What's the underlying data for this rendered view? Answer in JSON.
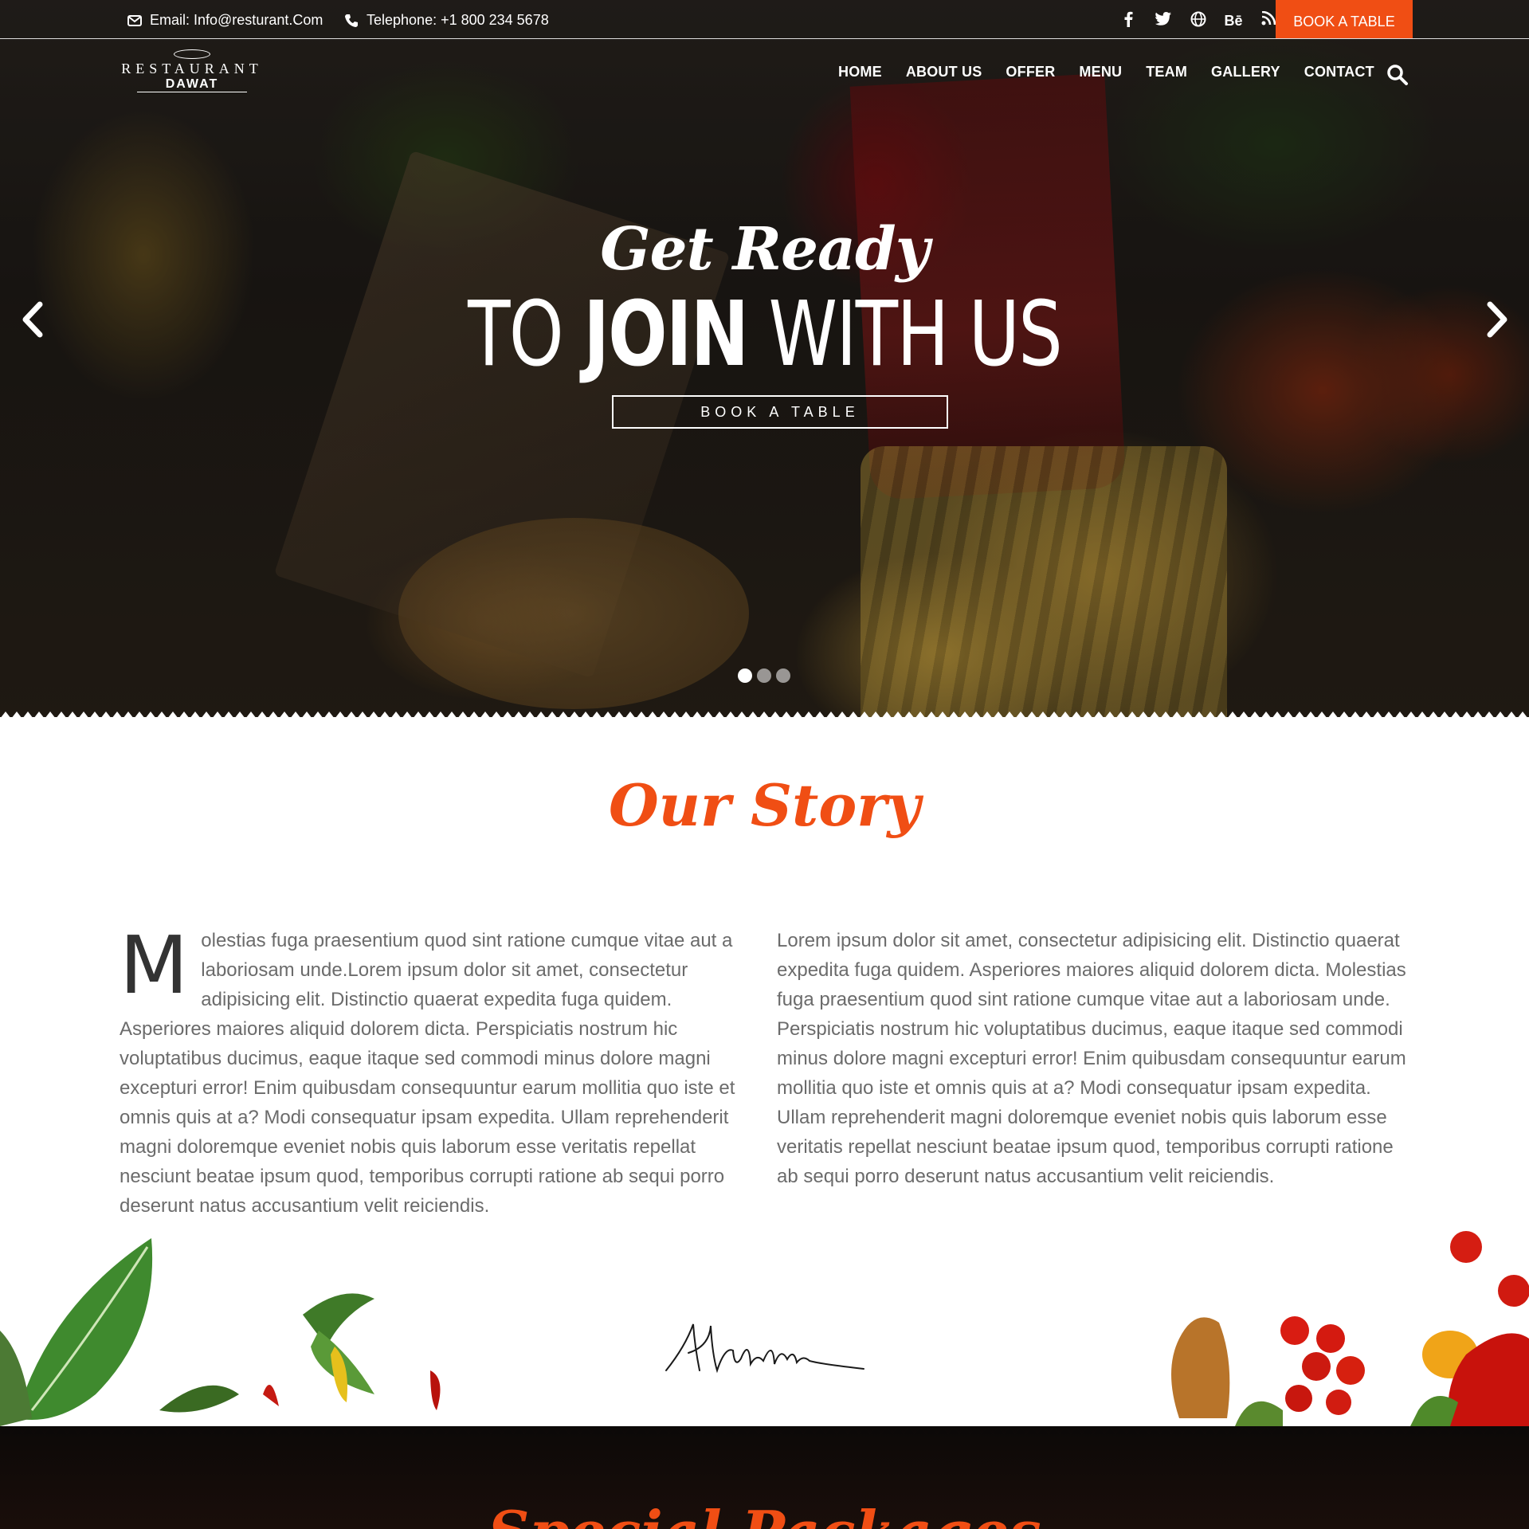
{
  "topbar": {
    "email_text": "Email: Info@resturant.Com",
    "phone_text": "Telephone: +1 800 234 5678",
    "social": [
      {
        "icon": "facebook-icon",
        "glyph": "f"
      },
      {
        "icon": "twitter-icon",
        "glyph": "t"
      },
      {
        "icon": "globe-icon",
        "glyph": "w"
      },
      {
        "icon": "behance-icon",
        "glyph": "Bē"
      },
      {
        "icon": "rss-icon",
        "glyph": "r"
      }
    ],
    "book_label": "BOOK A TABLE"
  },
  "logo": {
    "line1": "RESTAURANT",
    "line2": "DAWAT"
  },
  "nav": {
    "items": [
      "HOME",
      "ABOUT US",
      "OFFER",
      "MENU",
      "TEAM",
      "GALLERY",
      "CONTACT"
    ]
  },
  "hero": {
    "script": "Get Ready",
    "big_prefix": "TO ",
    "big_bold": "JOIN",
    "big_suffix": " WITH US",
    "button_label": "BOOK A TABLE",
    "slides_total": 3,
    "active_slide": 1
  },
  "story": {
    "title": "Our Story",
    "dropcap": "M",
    "left_text": "olestias fuga praesentium quod sint ratione cumque vitae aut a laboriosam unde.Lorem ipsum dolor sit amet, consectetur adipisicing elit. Distinctio quaerat expedita fuga quidem. Asperiores maiores aliquid dolorem dicta. Perspiciatis nostrum hic voluptatibus ducimus, eaque itaque sed commodi minus dolore magni excepturi error! Enim quibusdam consequuntur earum mollitia quo iste et omnis quis at a? Modi consequatur ipsam expedita. Ullam reprehenderit magni doloremque eveniet nobis quis laborum esse veritatis repellat nesciunt beatae ipsum quod, temporibus corrupti ratione ab sequi porro deserunt natus accusantium velit reiciendis.",
    "right_text": "Lorem ipsum dolor sit amet, consectetur adipisicing elit. Distinctio quaerat expedita fuga quidem. Asperiores maiores aliquid dolorem dicta. Molestias fuga praesentium quod sint ratione cumque vitae aut a laboriosam unde. Perspiciatis nostrum hic voluptatibus ducimus, eaque itaque sed commodi minus dolore magni excepturi error! Enim quibusdam consequuntur earum mollitia quo iste et omnis quis at a? Modi consequatur ipsam expedita. Ullam reprehenderit magni doloremque eveniet nobis quis laborum esse veritatis repellat nesciunt beatae ipsum quod, temporibus corrupti ratione ab sequi porro deserunt natus accusantium velit reiciendis."
  },
  "packages": {
    "title": "Special Packages"
  },
  "colors": {
    "accent": "#f04e14",
    "text": "#6b6b6b",
    "dark": "#0c0908"
  }
}
